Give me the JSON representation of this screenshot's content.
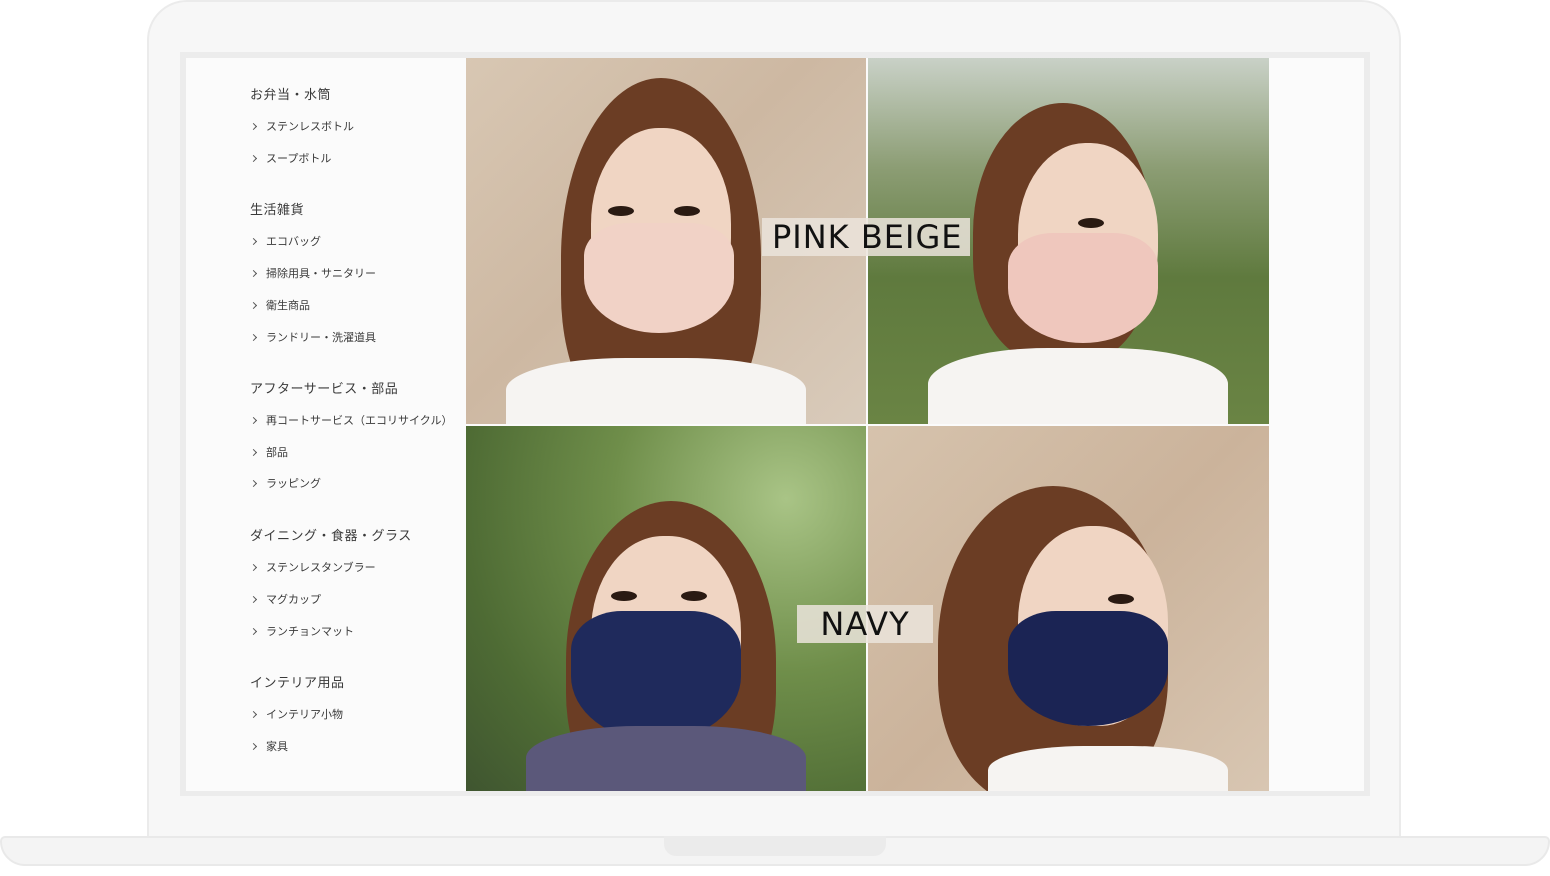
{
  "sidebar": {
    "categories": [
      {
        "heading": "お弁当・水筒",
        "items": [
          "ステンレスボトル",
          "スープボトル"
        ]
      },
      {
        "heading": "生活雑貨",
        "items": [
          "エコバッグ",
          "掃除用具・サニタリー",
          "衛生商品",
          "ランドリー・洗濯道具"
        ]
      },
      {
        "heading": "アフターサービス・部品",
        "items": [
          "再コートサービス（エコリサイクル）",
          "部品",
          "ラッピング"
        ]
      },
      {
        "heading": "ダイニング・食器・グラス",
        "items": [
          "ステンレスタンブラー",
          "マグカップ",
          "ランチョンマット"
        ]
      },
      {
        "heading": "インテリア用品",
        "items": [
          "インテリア小物",
          "家具"
        ]
      }
    ]
  },
  "hero": {
    "label_top": "PINK BEIGE",
    "label_bottom": "NAVY",
    "colors": {
      "pink_beige": "#f1d2c6",
      "navy": "#1f2a5c"
    }
  }
}
